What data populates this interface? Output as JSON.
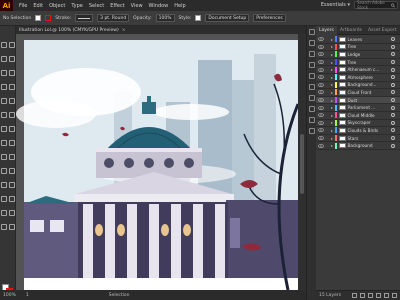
{
  "app": {
    "logo": "Ai",
    "brand_color": "#ff9a00"
  },
  "menu": [
    "File",
    "Edit",
    "Object",
    "Type",
    "Select",
    "Effect",
    "View",
    "Window",
    "Help"
  ],
  "workspace": {
    "label": "Essentials ▾"
  },
  "stock_search": {
    "placeholder": "Search Adobe Stock"
  },
  "control": {
    "selection_label": "No Selection",
    "stroke_label": "Stroke:",
    "brush_field": "3 pt. Round",
    "opacity_label": "Opacity:",
    "opacity_value": "100%",
    "style_label": "Style:",
    "doc_setup": "Document Setup",
    "preferences": "Preferences"
  },
  "document": {
    "tab_title": "Illustration Lol.@ 100% (CMYK/GPU Preview)",
    "close": "×"
  },
  "status": {
    "zoom": "100%",
    "page": "1",
    "tool": "Selection"
  },
  "layers_panel": {
    "tabs": [
      "Layers",
      "Artboards",
      "Asset Export"
    ],
    "rows": [
      {
        "name": "Leaves",
        "color": "#4f7fff"
      },
      {
        "name": "Tree",
        "color": "#ff4f4f"
      },
      {
        "name": "Ledge",
        "color": "#4fff4f"
      },
      {
        "name": "Tree",
        "color": "#4f4fff"
      },
      {
        "name": "Athenaeum c...",
        "color": "#ff4fff"
      },
      {
        "name": "Atmosphere",
        "color": "#4fffff"
      },
      {
        "name": "Background...",
        "color": "#ffff4f"
      },
      {
        "name": "Cloud Front",
        "color": "#ff9f4f"
      },
      {
        "name": "Dust",
        "color": "#bf4fff",
        "selected": true
      },
      {
        "name": "Parliament ...",
        "color": "#4fbfff"
      },
      {
        "name": "Cloud Middle",
        "color": "#ff4f9f"
      },
      {
        "name": "Skyscraper",
        "color": "#9fff4f"
      },
      {
        "name": "Clouds & Birds",
        "color": "#4f9fff"
      },
      {
        "name": "Stars",
        "color": "#ff6f6f"
      },
      {
        "name": "Background",
        "color": "#6fffaf"
      }
    ],
    "footer": "15 Layers"
  },
  "icons": {
    "tools": [
      "selection-tool-icon",
      "direct-selection-tool-icon",
      "magic-wand-icon",
      "lasso-icon",
      "pen-tool-icon",
      "curvature-icon",
      "type-tool-icon",
      "line-tool-icon",
      "rectangle-tool-icon",
      "paintbrush-icon",
      "pencil-icon",
      "eraser-icon",
      "rotate-icon",
      "scale-icon",
      "width-tool-icon",
      "free-transform-icon",
      "shape-builder-icon",
      "perspective-icon",
      "mesh-icon",
      "gradient-icon",
      "eyedropper-icon",
      "blend-icon",
      "symbol-sprayer-icon",
      "graph-icon",
      "artboard-icon",
      "slice-icon",
      "hand-icon",
      "zoom-icon"
    ]
  }
}
